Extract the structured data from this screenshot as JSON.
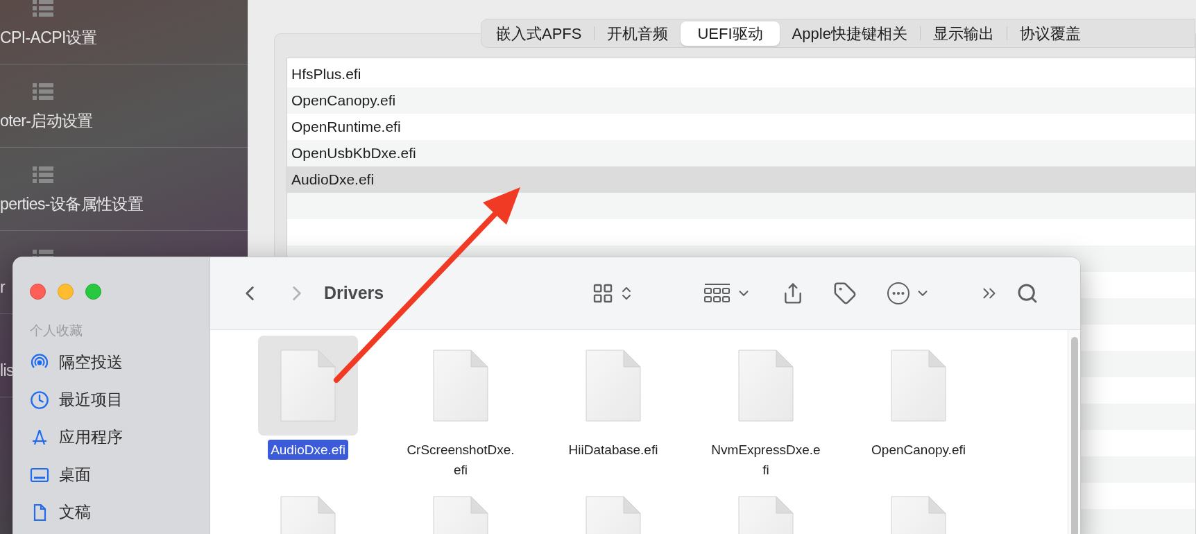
{
  "sidebar": {
    "items": [
      {
        "label": "CPI-ACPI设置"
      },
      {
        "label": "oter-启动设置"
      },
      {
        "label": "perties-设备属性设置"
      },
      {
        "label": "r"
      },
      {
        "label": "lis"
      }
    ]
  },
  "tabs": [
    {
      "label": "嵌入式APFS",
      "selected": false
    },
    {
      "label": "开机音频",
      "selected": false
    },
    {
      "label": "UEFI驱动",
      "selected": true
    },
    {
      "label": "Apple快捷键相关",
      "selected": false
    },
    {
      "label": "显示输出",
      "selected": false
    },
    {
      "label": "协议覆盖",
      "selected": false
    }
  ],
  "drivers_list": {
    "rows": [
      {
        "name": "HfsPlus.efi",
        "selected": false
      },
      {
        "name": "OpenCanopy.efi",
        "selected": false
      },
      {
        "name": "OpenRuntime.efi",
        "selected": false
      },
      {
        "name": "OpenUsbKbDxe.efi",
        "selected": false
      },
      {
        "name": "AudioDxe.efi",
        "selected": true
      }
    ]
  },
  "finder": {
    "title": "Drivers",
    "sidebar": {
      "section": "个人收藏",
      "items": [
        {
          "label": "隔空投送",
          "kind": "airdrop"
        },
        {
          "label": "最近项目",
          "kind": "recents"
        },
        {
          "label": "应用程序",
          "kind": "applications"
        },
        {
          "label": "桌面",
          "kind": "desktop"
        },
        {
          "label": "文稿",
          "kind": "documents"
        }
      ]
    },
    "files": [
      {
        "name": "AudioDxe.efi",
        "selected": true
      },
      {
        "name": "CrScreenshotDxe.efi",
        "selected": false
      },
      {
        "name": "HiiDatabase.efi",
        "selected": false
      },
      {
        "name": "NvmExpressDxe.efi",
        "selected": false
      },
      {
        "name": "OpenCanopy.efi",
        "selected": false
      }
    ]
  }
}
